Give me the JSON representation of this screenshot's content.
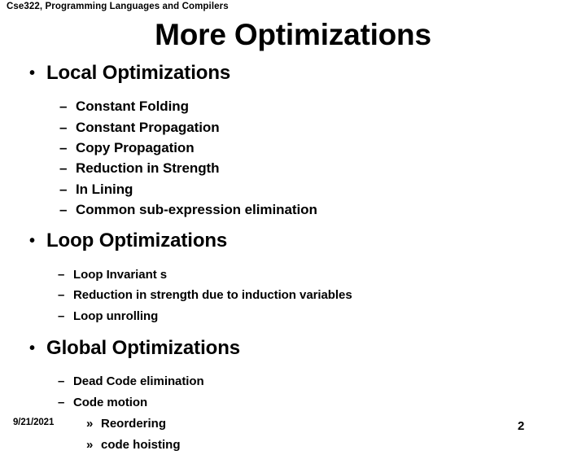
{
  "header": {
    "course_line": "Cse322, Programming Languages and Compilers"
  },
  "title": "More Optimizations",
  "sections": [
    {
      "heading": "Local Optimizations",
      "bullet_marker": "•",
      "items": [
        {
          "marker": "–",
          "text": "Constant Folding"
        },
        {
          "marker": "–",
          "text": "Constant Propagation"
        },
        {
          "marker": "–",
          "text": "Copy Propagation"
        },
        {
          "marker": "–",
          "text": "Reduction in Strength"
        },
        {
          "marker": "–",
          "text": "In Lining"
        },
        {
          "marker": "–",
          "text": "Common sub-expression elimination"
        }
      ]
    },
    {
      "heading": "Loop Optimizations",
      "bullet_marker": "•",
      "items": [
        {
          "marker": "–",
          "text": "Loop Invariant s"
        },
        {
          "marker": "–",
          "text": "Reduction in strength due to induction variables"
        },
        {
          "marker": "–",
          "text": "Loop unrolling"
        }
      ]
    },
    {
      "heading": "Global Optimizations",
      "bullet_marker": "•",
      "items": [
        {
          "marker": "–",
          "text": "Dead Code elimination"
        },
        {
          "marker": "–",
          "text": "Code motion"
        }
      ],
      "subitems": [
        {
          "marker": "»",
          "text": "Reordering"
        },
        {
          "marker": "»",
          "text": "code hoisting"
        }
      ]
    }
  ],
  "footer": {
    "date": "9/21/2021",
    "slide_number": "2"
  }
}
